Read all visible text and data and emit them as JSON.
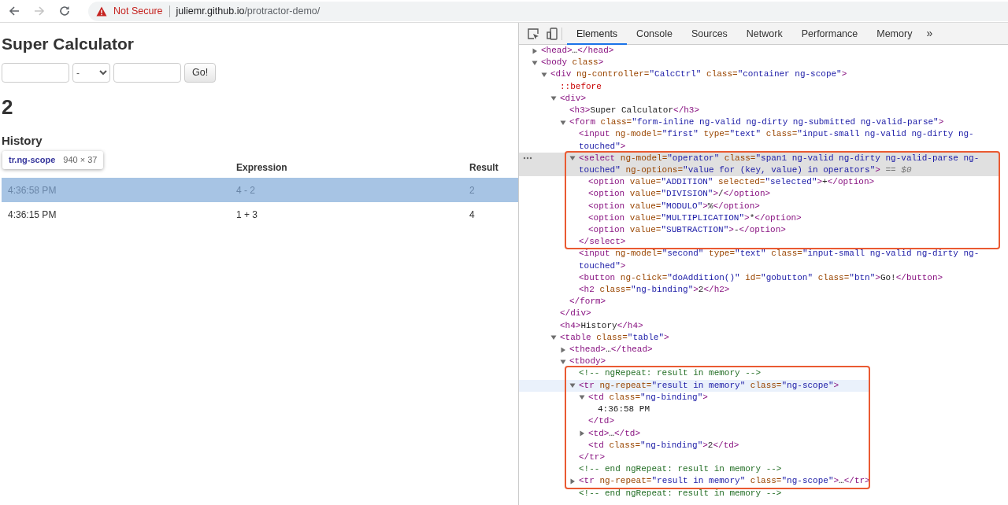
{
  "browser": {
    "back_enabled": true,
    "forward_enabled": false,
    "security": "Not Secure",
    "url_host": "juliemr.github.io",
    "url_path": "/protractor-demo/"
  },
  "page": {
    "title": "Super Calculator",
    "operator": "-",
    "go_button": "Go!",
    "result": "2",
    "history_title": "History",
    "table": {
      "columns": [
        {},
        {
          "label": "Expression"
        },
        {
          "label": "Result"
        }
      ],
      "rows": [
        {
          "highlighted": true,
          "cells": [
            "4:36:58 PM",
            "4 - 2",
            "2"
          ]
        },
        {
          "highlighted": false,
          "cells": [
            "4:36:15 PM",
            "1 + 3",
            "4"
          ]
        }
      ]
    },
    "tooltip": {
      "selector": "tr.ng-scope",
      "size": "940 × 37"
    }
  },
  "devtools": {
    "tabs": [
      {
        "label": "Elements",
        "selected": true
      },
      {
        "label": "Console",
        "selected": false
      },
      {
        "label": "Sources",
        "selected": false
      },
      {
        "label": "Network",
        "selected": false
      },
      {
        "label": "Performance",
        "selected": false
      },
      {
        "label": "Memory",
        "selected": false
      }
    ],
    "overflow": "»",
    "tree": [
      {
        "kind": "expandable",
        "expanded": false,
        "selected": false,
        "tokens": [
          {
            "kind": "tag",
            "text": "<head>"
          },
          {
            "kind": "text",
            "text": "…"
          },
          {
            "kind": "tag",
            "text": "</head>"
          }
        ]
      },
      {
        "kind": "expandable",
        "expanded": true,
        "selected": false,
        "tokens": [
          {
            "kind": "tag",
            "text": "<body"
          },
          {
            "kind": "attr",
            "text": " class"
          },
          {
            "kind": "tag",
            "text": ">"
          }
        ],
        "children": [
          {
            "kind": "expandable",
            "expanded": true,
            "selected": false,
            "tokens": [
              {
                "kind": "tag",
                "text": "<div"
              },
              {
                "kind": "attr",
                "text": " ng-controller="
              },
              {
                "kind": "value",
                "text": "\"CalcCtrl\""
              },
              {
                "kind": "attr",
                "text": " class="
              },
              {
                "kind": "value",
                "text": "\"container ng-scope\""
              },
              {
                "kind": "tag",
                "text": ">"
              }
            ],
            "children": [
              {
                "kind": "leaf",
                "selected": false,
                "tokens": [
                  {
                    "kind": "pseudo",
                    "text": "::before"
                  }
                ]
              },
              {
                "kind": "expandable",
                "expanded": true,
                "selected": false,
                "tokens": [
                  {
                    "kind": "tag",
                    "text": "<div>"
                  }
                ],
                "closing": [
                  {
                    "kind": "tag",
                    "text": "</div>"
                  }
                ],
                "children": [
                  {
                    "kind": "leaf",
                    "selected": false,
                    "tokens": [
                      {
                        "kind": "tag",
                        "text": "<h3>"
                      },
                      {
                        "kind": "text",
                        "text": "Super Calculator"
                      },
                      {
                        "kind": "tag",
                        "text": "</h3>"
                      }
                    ]
                  },
                  {
                    "kind": "expandable",
                    "expanded": true,
                    "selected": false,
                    "tokens": [
                      {
                        "kind": "tag",
                        "text": "<form"
                      },
                      {
                        "kind": "attr",
                        "text": " class="
                      },
                      {
                        "kind": "value",
                        "text": "\"form-inline ng-valid ng-dirty ng-submitted ng-valid-parse\""
                      },
                      {
                        "kind": "tag",
                        "text": ">"
                      }
                    ],
                    "closing": [
                      {
                        "kind": "tag",
                        "text": "</form>"
                      }
                    ],
                    "children": [
                      {
                        "kind": "leaf",
                        "selected": false,
                        "tokens": [
                          {
                            "kind": "tag",
                            "text": "<input"
                          },
                          {
                            "kind": "attr",
                            "text": " ng-model="
                          },
                          {
                            "kind": "value",
                            "text": "\"first\""
                          },
                          {
                            "kind": "attr",
                            "text": " type="
                          },
                          {
                            "kind": "value",
                            "text": "\"text\""
                          },
                          {
                            "kind": "attr",
                            "text": " class="
                          },
                          {
                            "kind": "value",
                            "text": "\"input-small ng-valid ng-dirty ng-touched\""
                          },
                          {
                            "kind": "tag",
                            "text": ">"
                          }
                        ]
                      },
                      {
                        "kind": "expandable",
                        "expanded": true,
                        "selected": true,
                        "outlined": true,
                        "tokens": [
                          {
                            "kind": "tag",
                            "text": "<select"
                          },
                          {
                            "kind": "attr",
                            "text": " ng-model="
                          },
                          {
                            "kind": "value",
                            "text": "\"operator\""
                          },
                          {
                            "kind": "attr",
                            "text": " class="
                          },
                          {
                            "kind": "value",
                            "text": "\"span1 ng-valid ng-dirty ng-valid-parse ng-touched\""
                          },
                          {
                            "kind": "attr",
                            "text": " ng-options="
                          },
                          {
                            "kind": "value",
                            "text": "\"value for (key, value) in operators\""
                          },
                          {
                            "kind": "tag",
                            "text": ">"
                          },
                          {
                            "kind": "hint",
                            "text": " == "
                          },
                          {
                            "kind": "ref",
                            "text": "$0"
                          }
                        ],
                        "closing": [
                          {
                            "kind": "tag",
                            "text": "</select>"
                          }
                        ],
                        "children": [
                          {
                            "kind": "leaf",
                            "selected": false,
                            "tokens": [
                              {
                                "kind": "tag",
                                "text": "<option"
                              },
                              {
                                "kind": "attr",
                                "text": " value="
                              },
                              {
                                "kind": "value",
                                "text": "\"ADDITION\""
                              },
                              {
                                "kind": "attr",
                                "text": " selected="
                              },
                              {
                                "kind": "value",
                                "text": "\"selected\""
                              },
                              {
                                "kind": "tag",
                                "text": ">"
                              },
                              {
                                "kind": "text",
                                "text": "+"
                              },
                              {
                                "kind": "tag",
                                "text": "</option>"
                              }
                            ]
                          },
                          {
                            "kind": "leaf",
                            "selected": false,
                            "tokens": [
                              {
                                "kind": "tag",
                                "text": "<option"
                              },
                              {
                                "kind": "attr",
                                "text": " value="
                              },
                              {
                                "kind": "value",
                                "text": "\"DIVISION\""
                              },
                              {
                                "kind": "tag",
                                "text": ">"
                              },
                              {
                                "kind": "text",
                                "text": "/"
                              },
                              {
                                "kind": "tag",
                                "text": "</option>"
                              }
                            ]
                          },
                          {
                            "kind": "leaf",
                            "selected": false,
                            "tokens": [
                              {
                                "kind": "tag",
                                "text": "<option"
                              },
                              {
                                "kind": "attr",
                                "text": " value="
                              },
                              {
                                "kind": "value",
                                "text": "\"MODULO\""
                              },
                              {
                                "kind": "tag",
                                "text": ">"
                              },
                              {
                                "kind": "text",
                                "text": "%"
                              },
                              {
                                "kind": "tag",
                                "text": "</option>"
                              }
                            ]
                          },
                          {
                            "kind": "leaf",
                            "selected": false,
                            "tokens": [
                              {
                                "kind": "tag",
                                "text": "<option"
                              },
                              {
                                "kind": "attr",
                                "text": " value="
                              },
                              {
                                "kind": "value",
                                "text": "\"MULTIPLICATION\""
                              },
                              {
                                "kind": "tag",
                                "text": ">"
                              },
                              {
                                "kind": "text",
                                "text": "*"
                              },
                              {
                                "kind": "tag",
                                "text": "</option>"
                              }
                            ]
                          },
                          {
                            "kind": "leaf",
                            "selected": false,
                            "tokens": [
                              {
                                "kind": "tag",
                                "text": "<option"
                              },
                              {
                                "kind": "attr",
                                "text": " value="
                              },
                              {
                                "kind": "value",
                                "text": "\"SUBTRACTION\""
                              },
                              {
                                "kind": "tag",
                                "text": ">"
                              },
                              {
                                "kind": "text",
                                "text": "-"
                              },
                              {
                                "kind": "tag",
                                "text": "</option>"
                              }
                            ]
                          }
                        ]
                      },
                      {
                        "kind": "leaf",
                        "selected": false,
                        "tokens": [
                          {
                            "kind": "tag",
                            "text": "<input"
                          },
                          {
                            "kind": "attr",
                            "text": " ng-model="
                          },
                          {
                            "kind": "value",
                            "text": "\"second\""
                          },
                          {
                            "kind": "attr",
                            "text": " type="
                          },
                          {
                            "kind": "value",
                            "text": "\"text\""
                          },
                          {
                            "kind": "attr",
                            "text": " class="
                          },
                          {
                            "kind": "value",
                            "text": "\"input-small ng-valid ng-dirty ng-touched\""
                          },
                          {
                            "kind": "tag",
                            "text": ">"
                          }
                        ]
                      },
                      {
                        "kind": "leaf",
                        "selected": false,
                        "tokens": [
                          {
                            "kind": "tag",
                            "text": "<button"
                          },
                          {
                            "kind": "attr",
                            "text": " ng-click="
                          },
                          {
                            "kind": "value",
                            "text": "\"doAddition()\""
                          },
                          {
                            "kind": "attr",
                            "text": " id="
                          },
                          {
                            "kind": "value",
                            "text": "\"gobutton\""
                          },
                          {
                            "kind": "attr",
                            "text": " class="
                          },
                          {
                            "kind": "value",
                            "text": "\"btn\""
                          },
                          {
                            "kind": "tag",
                            "text": ">"
                          },
                          {
                            "kind": "text",
                            "text": "Go!"
                          },
                          {
                            "kind": "tag",
                            "text": "</button>"
                          }
                        ]
                      },
                      {
                        "kind": "leaf",
                        "selected": false,
                        "tokens": [
                          {
                            "kind": "tag",
                            "text": "<h2"
                          },
                          {
                            "kind": "attr",
                            "text": " class="
                          },
                          {
                            "kind": "value",
                            "text": "\"ng-binding\""
                          },
                          {
                            "kind": "tag",
                            "text": ">"
                          },
                          {
                            "kind": "text",
                            "text": "2"
                          },
                          {
                            "kind": "tag",
                            "text": "</h2>"
                          }
                        ]
                      }
                    ]
                  }
                ]
              },
              {
                "kind": "leaf",
                "selected": false,
                "tokens": [
                  {
                    "kind": "tag",
                    "text": "<h4>"
                  },
                  {
                    "kind": "text",
                    "text": "History"
                  },
                  {
                    "kind": "tag",
                    "text": "</h4>"
                  }
                ]
              },
              {
                "kind": "expandable",
                "expanded": true,
                "selected": false,
                "tokens": [
                  {
                    "kind": "tag",
                    "text": "<table"
                  },
                  {
                    "kind": "attr",
                    "text": " class="
                  },
                  {
                    "kind": "value",
                    "text": "\"table\""
                  },
                  {
                    "kind": "tag",
                    "text": ">"
                  }
                ],
                "children": [
                  {
                    "kind": "expandable",
                    "expanded": false,
                    "selected": false,
                    "tokens": [
                      {
                        "kind": "tag",
                        "text": "<thead>"
                      },
                      {
                        "kind": "text",
                        "text": "…"
                      },
                      {
                        "kind": "tag",
                        "text": "</thead>"
                      }
                    ]
                  },
                  {
                    "kind": "expandable",
                    "expanded": true,
                    "selected": false,
                    "tokens": [
                      {
                        "kind": "tag",
                        "text": "<tbody>"
                      }
                    ],
                    "children": [
                      {
                        "kind": "leaf",
                        "selected": false,
                        "outlined": true,
                        "tokens": [
                          {
                            "kind": "comment",
                            "text": "<!-- ngRepeat: result in memory -->"
                          }
                        ]
                      },
                      {
                        "kind": "expandable",
                        "expanded": true,
                        "selected": false,
                        "hovered": true,
                        "outlined": true,
                        "tokens": [
                          {
                            "kind": "tag",
                            "text": "<tr"
                          },
                          {
                            "kind": "attr",
                            "text": " ng-repeat="
                          },
                          {
                            "kind": "value",
                            "text": "\"result in memory\""
                          },
                          {
                            "kind": "attr",
                            "text": " class="
                          },
                          {
                            "kind": "value",
                            "text": "\"ng-scope\""
                          },
                          {
                            "kind": "tag",
                            "text": ">"
                          }
                        ],
                        "closing": [
                          {
                            "kind": "tag",
                            "text": "</tr>"
                          }
                        ],
                        "children": [
                          {
                            "kind": "expandable",
                            "expanded": true,
                            "selected": false,
                            "tokens": [
                              {
                                "kind": "tag",
                                "text": "<td"
                              },
                              {
                                "kind": "attr",
                                "text": " class="
                              },
                              {
                                "kind": "value",
                                "text": "\"ng-binding\""
                              },
                              {
                                "kind": "tag",
                                "text": ">"
                              }
                            ],
                            "closing": [
                              {
                                "kind": "tag",
                                "text": "</td>"
                              }
                            ],
                            "children": [
                              {
                                "kind": "leaf",
                                "selected": false,
                                "tokens": [
                                  {
                                    "kind": "text",
                                    "text": "4:36:58 PM"
                                  }
                                ]
                              }
                            ]
                          },
                          {
                            "kind": "expandable",
                            "expanded": false,
                            "selected": false,
                            "tokens": [
                              {
                                "kind": "tag",
                                "text": "<td>"
                              },
                              {
                                "kind": "text",
                                "text": "…"
                              },
                              {
                                "kind": "tag",
                                "text": "</td>"
                              }
                            ]
                          },
                          {
                            "kind": "leaf",
                            "selected": false,
                            "tokens": [
                              {
                                "kind": "tag",
                                "text": "<td"
                              },
                              {
                                "kind": "attr",
                                "text": " class="
                              },
                              {
                                "kind": "value",
                                "text": "\"ng-binding\""
                              },
                              {
                                "kind": "tag",
                                "text": ">"
                              },
                              {
                                "kind": "text",
                                "text": "2"
                              },
                              {
                                "kind": "tag",
                                "text": "</td>"
                              }
                            ]
                          }
                        ]
                      },
                      {
                        "kind": "leaf",
                        "selected": false,
                        "outlined": true,
                        "tokens": [
                          {
                            "kind": "comment",
                            "text": "<!-- end ngRepeat: result in memory -->"
                          }
                        ]
                      },
                      {
                        "kind": "expandable",
                        "expanded": false,
                        "selected": false,
                        "outlined": true,
                        "tokens": [
                          {
                            "kind": "tag",
                            "text": "<tr"
                          },
                          {
                            "kind": "attr",
                            "text": " ng-repeat="
                          },
                          {
                            "kind": "value",
                            "text": "\"result in memory\""
                          },
                          {
                            "kind": "attr",
                            "text": " class="
                          },
                          {
                            "kind": "value",
                            "text": "\"ng-scope\""
                          },
                          {
                            "kind": "tag",
                            "text": ">"
                          },
                          {
                            "kind": "text",
                            "text": "…"
                          },
                          {
                            "kind": "tag",
                            "text": "</tr>"
                          }
                        ]
                      },
                      {
                        "kind": "leaf",
                        "selected": false,
                        "tokens": [
                          {
                            "kind": "comment",
                            "text": "<!-- end ngRepeat: result in memory -->"
                          }
                        ]
                      }
                    ]
                  }
                ]
              }
            ]
          }
        ]
      }
    ]
  }
}
